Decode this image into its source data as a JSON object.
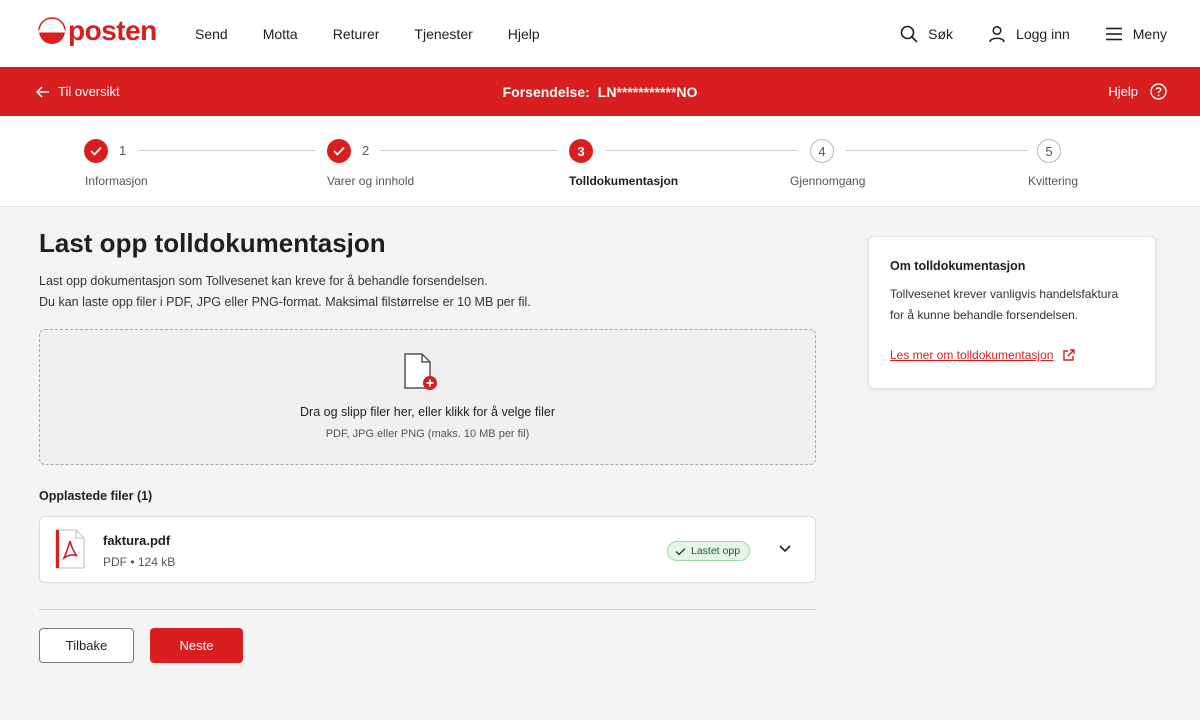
{
  "brand": {
    "name": "posten",
    "color": "#d81e1e"
  },
  "nav": {
    "links": [
      "Send",
      "Motta",
      "Returer",
      "Tjenester",
      "Hjelp"
    ],
    "search_label": "Søk",
    "login_label": "Logg inn",
    "menu_label": "Meny"
  },
  "header_bar": {
    "back_label": "Til oversikt",
    "shipment_label": "Forsendelse:",
    "shipment_id": "LN***********NO",
    "help_label": "Hjelp"
  },
  "stepper": {
    "steps": [
      {
        "number": "1",
        "label": "Informasjon",
        "state": "done"
      },
      {
        "number": "2",
        "label": "Varer og innhold",
        "state": "done"
      },
      {
        "number": "3",
        "label": "Tolldokumentasjon",
        "state": "active"
      },
      {
        "number": "4",
        "label": "Gjennomgang",
        "state": "pending"
      },
      {
        "number": "5",
        "label": "Kvittering",
        "state": "pending"
      }
    ]
  },
  "main": {
    "title": "Last opp tolldokumentasjon",
    "description_1": "Last opp dokumentasjon som Tollvesenet kan kreve for å behandle forsendelsen.",
    "description_2": "Du kan laste opp filer i PDF, JPG eller PNG-format. Maksimal filstørrelse er 10 MB per fil.",
    "dropzone": {
      "icon": "file-add-icon",
      "main_text": "Dra og slipp filer her, eller klikk for å velge filer",
      "sub_text": "PDF, JPG eller PNG (maks. 10 MB per fil)"
    },
    "uploaded_title": "Opplastede filer (1)",
    "files": [
      {
        "name": "faktura.pdf",
        "meta": "PDF • 124 kB",
        "status": "Lastet opp",
        "icon": "pdf-icon"
      }
    ],
    "buttons": {
      "back": "Tilbake",
      "next": "Neste"
    }
  },
  "sidebar": {
    "title": "Om tolldokumentasjon",
    "body_1": "Tollvesenet krever vanligvis handelsfaktura",
    "body_2": "for å kunne behandle forsendelsen.",
    "link": "Les mer om tolldokumentasjon"
  },
  "colors": {
    "accent": "#d81e1e",
    "success_bg": "#e5f5e8",
    "success_text": "#1f5a2c"
  }
}
